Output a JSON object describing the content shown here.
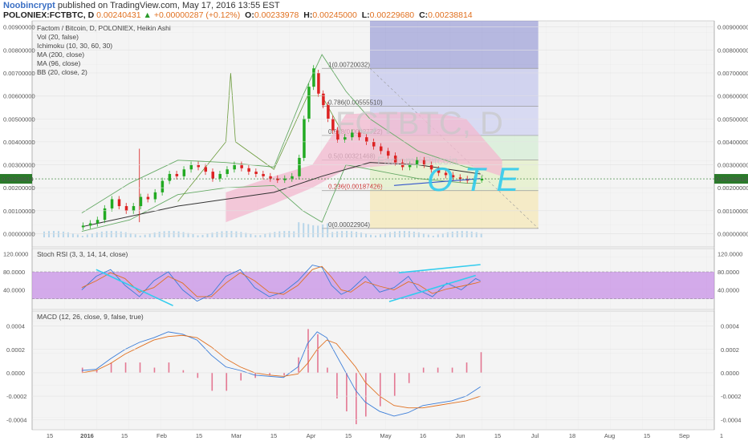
{
  "header": {
    "author": "Noobincrypt",
    "published": "published on TradingView.com, May 17, 2016 13:55 EST",
    "symbol": "POLONIEX:FCTBTC, D",
    "last": "0.00240431",
    "change_arrow": "▲",
    "change": "+0.00000287 (+0.12%)",
    "o_label": "O:",
    "o": "0.00233978",
    "h_label": "H:",
    "h": "0.00245000",
    "l_label": "L:",
    "l": "0.00229680",
    "c_label": "C:",
    "c": "0.00238814"
  },
  "legend": {
    "main": [
      "Factom / Bitcoin, D, POLONIEX, Heikin Ashi",
      "Vol (20, false)",
      "Ichimoku (10, 30, 60, 30)",
      "MA (200, close)",
      "MA (96, close)",
      "BB (20, close, 2)"
    ],
    "stoch": "Stoch RSI (3, 3, 14, 14, close)",
    "macd": "MACD (12, 26, close, 9, false, true)"
  },
  "watermark": "FCTBTC, D",
  "watermark_sub": "Factom / Bitcoin",
  "annotation": "OTE",
  "colors": {
    "up": "#22aa22",
    "down": "#dd2222",
    "fib_box": "#6a6fc8",
    "cloud": "#f3b8cf",
    "annotation": "#33ccee",
    "stoch_band": "#c58ae6",
    "price_tag": "#2a7a2a"
  },
  "chart_data": [
    {
      "type": "candlestick",
      "title": "Factom / Bitcoin, D, POLONIEX, Heikin Ashi",
      "x_ticks": [
        "15",
        "2016",
        "15",
        "Feb",
        "15",
        "Mar",
        "15",
        "Apr",
        "15",
        "May",
        "16",
        "Jun",
        "15",
        "Jul",
        "18",
        "Aug",
        "15",
        "Sep",
        "1"
      ],
      "y_ticks": [
        0.009,
        0.008,
        0.007,
        0.006,
        0.005,
        0.004,
        0.003,
        0.002,
        0.001,
        0.0
      ],
      "y_tick_labels": [
        "0.00900000",
        "0.00800000",
        "0.00700000",
        "0.00600000",
        "0.00500000",
        "0.00400000",
        "0.00300000",
        "0.00200000",
        "0.00100000",
        "0.00000000"
      ],
      "ylim": [
        -0.0003,
        0.0092
      ],
      "last_price": 0.00238814,
      "last_price_label": "0.00238814",
      "fibonacci": [
        {
          "level": "1",
          "price": 0.00720032,
          "label": "1(0.00720032)"
        },
        {
          "level": "0.786",
          "price": 0.0055551,
          "label": "0.786(0.00555510)"
        },
        {
          "level": "0.618",
          "price": 0.00427722,
          "label": "0.618(0.00427722)"
        },
        {
          "level": "0.5",
          "price": 0.00321468,
          "label": "0.5(0.00321468)"
        },
        {
          "level": "0.236",
          "price": 0.00187426,
          "label": "0.236(0.00187426)"
        },
        {
          "level": "0",
          "price": 0.00022904,
          "label": "0(0.00022904)"
        }
      ],
      "candles": [
        {
          "d": 0,
          "o": 0.0003,
          "c": 0.00035
        },
        {
          "d": 3,
          "o": 0.00035,
          "c": 0.00045
        },
        {
          "d": 6,
          "o": 0.00045,
          "c": 0.0006
        },
        {
          "d": 9,
          "o": 0.0006,
          "c": 0.0011
        },
        {
          "d": 12,
          "o": 0.0011,
          "c": 0.0015
        },
        {
          "d": 15,
          "o": 0.0015,
          "c": 0.0012
        },
        {
          "d": 18,
          "o": 0.0012,
          "c": 0.001
        },
        {
          "d": 21,
          "o": 0.001,
          "c": 0.0012
        },
        {
          "d": 24,
          "o": 0.0012,
          "c": 0.0016
        },
        {
          "d": 27,
          "o": 0.0016,
          "c": 0.0015
        },
        {
          "d": 30,
          "o": 0.0015,
          "c": 0.0018
        },
        {
          "d": 33,
          "o": 0.0018,
          "c": 0.0023
        },
        {
          "d": 36,
          "o": 0.0023,
          "c": 0.0026
        },
        {
          "d": 39,
          "o": 0.0026,
          "c": 0.0025
        },
        {
          "d": 42,
          "o": 0.0025,
          "c": 0.0028
        },
        {
          "d": 45,
          "o": 0.0028,
          "c": 0.003
        },
        {
          "d": 48,
          "o": 0.003,
          "c": 0.0029
        },
        {
          "d": 51,
          "o": 0.0029,
          "c": 0.0027
        },
        {
          "d": 54,
          "o": 0.0027,
          "c": 0.0024
        },
        {
          "d": 57,
          "o": 0.0024,
          "c": 0.0026
        },
        {
          "d": 60,
          "o": 0.0026,
          "c": 0.0028
        },
        {
          "d": 63,
          "o": 0.0028,
          "c": 0.003
        },
        {
          "d": 66,
          "o": 0.003,
          "c": 0.00285
        },
        {
          "d": 69,
          "o": 0.00285,
          "c": 0.0027
        },
        {
          "d": 72,
          "o": 0.0027,
          "c": 0.0026
        },
        {
          "d": 75,
          "o": 0.0026,
          "c": 0.0025
        },
        {
          "d": 78,
          "o": 0.0025,
          "c": 0.0024
        },
        {
          "d": 81,
          "o": 0.0024,
          "c": 0.00235
        },
        {
          "d": 84,
          "o": 0.00235,
          "c": 0.0024
        },
        {
          "d": 87,
          "o": 0.0024,
          "c": 0.0025
        },
        {
          "d": 90,
          "o": 0.0025,
          "c": 0.0033
        },
        {
          "d": 92,
          "o": 0.0033,
          "c": 0.005
        },
        {
          "d": 94,
          "o": 0.005,
          "c": 0.0064
        },
        {
          "d": 96,
          "o": 0.0064,
          "c": 0.0072
        },
        {
          "d": 98,
          "o": 0.007,
          "c": 0.0061
        },
        {
          "d": 100,
          "o": 0.0061,
          "c": 0.0056
        },
        {
          "d": 102,
          "o": 0.0056,
          "c": 0.005
        },
        {
          "d": 104,
          "o": 0.005,
          "c": 0.0045
        },
        {
          "d": 106,
          "o": 0.0045,
          "c": 0.0041
        },
        {
          "d": 109,
          "o": 0.0041,
          "c": 0.0042
        },
        {
          "d": 112,
          "o": 0.0042,
          "c": 0.0044
        },
        {
          "d": 115,
          "o": 0.0044,
          "c": 0.0042
        },
        {
          "d": 118,
          "o": 0.0042,
          "c": 0.004
        },
        {
          "d": 121,
          "o": 0.004,
          "c": 0.0038
        },
        {
          "d": 124,
          "o": 0.0038,
          "c": 0.0036
        },
        {
          "d": 127,
          "o": 0.0036,
          "c": 0.0034
        },
        {
          "d": 130,
          "o": 0.0034,
          "c": 0.0031
        },
        {
          "d": 133,
          "o": 0.0031,
          "c": 0.0029
        },
        {
          "d": 136,
          "o": 0.0029,
          "c": 0.003
        },
        {
          "d": 139,
          "o": 0.003,
          "c": 0.0032
        },
        {
          "d": 142,
          "o": 0.0032,
          "c": 0.003
        },
        {
          "d": 145,
          "o": 0.003,
          "c": 0.0028
        },
        {
          "d": 148,
          "o": 0.0028,
          "c": 0.00265
        },
        {
          "d": 151,
          "o": 0.00265,
          "c": 0.00255
        },
        {
          "d": 154,
          "o": 0.00255,
          "c": 0.00245
        },
        {
          "d": 157,
          "o": 0.00245,
          "c": 0.00238
        },
        {
          "d": 160,
          "o": 0.00238,
          "c": 0.00233
        },
        {
          "d": 163,
          "o": 0.00233,
          "c": 0.00236
        },
        {
          "d": 166,
          "o": 0.00236,
          "c": 0.00239
        }
      ],
      "fib_range": [
        120,
        170
      ]
    },
    {
      "type": "line",
      "title": "Stoch RSI (3, 3, 14, 14, close)",
      "y_ticks": [
        120,
        80,
        40
      ],
      "y_tick_labels": [
        "120.0000",
        "80.0000",
        "40.0000"
      ],
      "ylim": [
        0,
        128
      ],
      "band": [
        20,
        80
      ],
      "series": [
        {
          "key": "k",
          "points": [
            [
              0,
              40
            ],
            [
              6,
              70
            ],
            [
              12,
              85
            ],
            [
              18,
              50
            ],
            [
              24,
              25
            ],
            [
              30,
              60
            ],
            [
              36,
              80
            ],
            [
              42,
              40
            ],
            [
              48,
              15
            ],
            [
              54,
              30
            ],
            [
              60,
              70
            ],
            [
              66,
              85
            ],
            [
              72,
              45
            ],
            [
              78,
              25
            ],
            [
              84,
              35
            ],
            [
              90,
              60
            ],
            [
              96,
              95
            ],
            [
              100,
              90
            ],
            [
              104,
              50
            ],
            [
              108,
              30
            ],
            [
              112,
              40
            ],
            [
              118,
              70
            ],
            [
              124,
              35
            ],
            [
              130,
              45
            ],
            [
              136,
              70
            ],
            [
              140,
              40
            ],
            [
              146,
              25
            ],
            [
              152,
              55
            ],
            [
              158,
              40
            ],
            [
              164,
              65
            ],
            [
              166,
              60
            ]
          ]
        },
        {
          "key": "d",
          "points": [
            [
              0,
              45
            ],
            [
              6,
              60
            ],
            [
              12,
              78
            ],
            [
              18,
              65
            ],
            [
              24,
              35
            ],
            [
              30,
              45
            ],
            [
              36,
              70
            ],
            [
              42,
              55
            ],
            [
              48,
              25
            ],
            [
              54,
              25
            ],
            [
              60,
              55
            ],
            [
              66,
              78
            ],
            [
              72,
              60
            ],
            [
              78,
              35
            ],
            [
              84,
              30
            ],
            [
              90,
              50
            ],
            [
              96,
              85
            ],
            [
              100,
              92
            ],
            [
              104,
              68
            ],
            [
              108,
              40
            ],
            [
              112,
              35
            ],
            [
              118,
              58
            ],
            [
              124,
              48
            ],
            [
              130,
              40
            ],
            [
              136,
              58
            ],
            [
              140,
              52
            ],
            [
              146,
              32
            ],
            [
              152,
              42
            ],
            [
              158,
              48
            ],
            [
              164,
              55
            ],
            [
              166,
              58
            ]
          ]
        }
      ]
    },
    {
      "type": "line",
      "title": "MACD (12, 26, close, 9, false, true)",
      "y_ticks": [
        0.0004,
        0.0002,
        0.0,
        -0.0002,
        -0.0004
      ],
      "y_tick_labels": [
        "0.0004",
        "0.0002",
        "0.0000",
        "-0.0002",
        "-0.0004"
      ],
      "ylim": [
        -0.00046,
        0.0005
      ],
      "series": [
        {
          "key": "macd",
          "points": [
            [
              0,
              2e-05
            ],
            [
              6,
              3e-05
            ],
            [
              12,
              0.00012
            ],
            [
              18,
              0.0002
            ],
            [
              24,
              0.00026
            ],
            [
              30,
              0.0003
            ],
            [
              36,
              0.00035
            ],
            [
              42,
              0.00033
            ],
            [
              48,
              0.00028
            ],
            [
              54,
              0.00015
            ],
            [
              60,
              5e-05
            ],
            [
              66,
              2e-05
            ],
            [
              72,
              -2e-05
            ],
            [
              78,
              -3e-05
            ],
            [
              84,
              -4e-05
            ],
            [
              90,
              5e-05
            ],
            [
              94,
              0.00025
            ],
            [
              98,
              0.00035
            ],
            [
              102,
              0.0003
            ],
            [
              106,
              0.00015
            ],
            [
              110,
              0.0
            ],
            [
              114,
              -0.00015
            ],
            [
              118,
              -0.00025
            ],
            [
              124,
              -0.00033
            ],
            [
              130,
              -0.00037
            ],
            [
              136,
              -0.00034
            ],
            [
              142,
              -0.00028
            ],
            [
              148,
              -0.00026
            ],
            [
              154,
              -0.00024
            ],
            [
              160,
              -0.0002
            ],
            [
              166,
              -0.00012
            ]
          ]
        },
        {
          "key": "signal",
          "points": [
            [
              0,
              0.0
            ],
            [
              6,
              2e-05
            ],
            [
              12,
              8e-05
            ],
            [
              18,
              0.00016
            ],
            [
              24,
              0.00022
            ],
            [
              30,
              0.00028
            ],
            [
              36,
              0.00031
            ],
            [
              42,
              0.00032
            ],
            [
              48,
              0.0003
            ],
            [
              54,
              0.00022
            ],
            [
              60,
              0.00012
            ],
            [
              66,
              5e-05
            ],
            [
              72,
              0.0
            ],
            [
              78,
              -2e-05
            ],
            [
              84,
              -3e-05
            ],
            [
              90,
              -1e-05
            ],
            [
              94,
              8e-05
            ],
            [
              98,
              0.0002
            ],
            [
              102,
              0.00028
            ],
            [
              106,
              0.00025
            ],
            [
              110,
              0.00015
            ],
            [
              114,
              5e-05
            ],
            [
              118,
              -8e-05
            ],
            [
              124,
              -0.0002
            ],
            [
              130,
              -0.00028
            ],
            [
              136,
              -0.0003
            ],
            [
              142,
              -0.0003
            ],
            [
              148,
              -0.00028
            ],
            [
              154,
              -0.00026
            ],
            [
              160,
              -0.00024
            ],
            [
              166,
              -0.0002
            ]
          ]
        }
      ]
    }
  ]
}
